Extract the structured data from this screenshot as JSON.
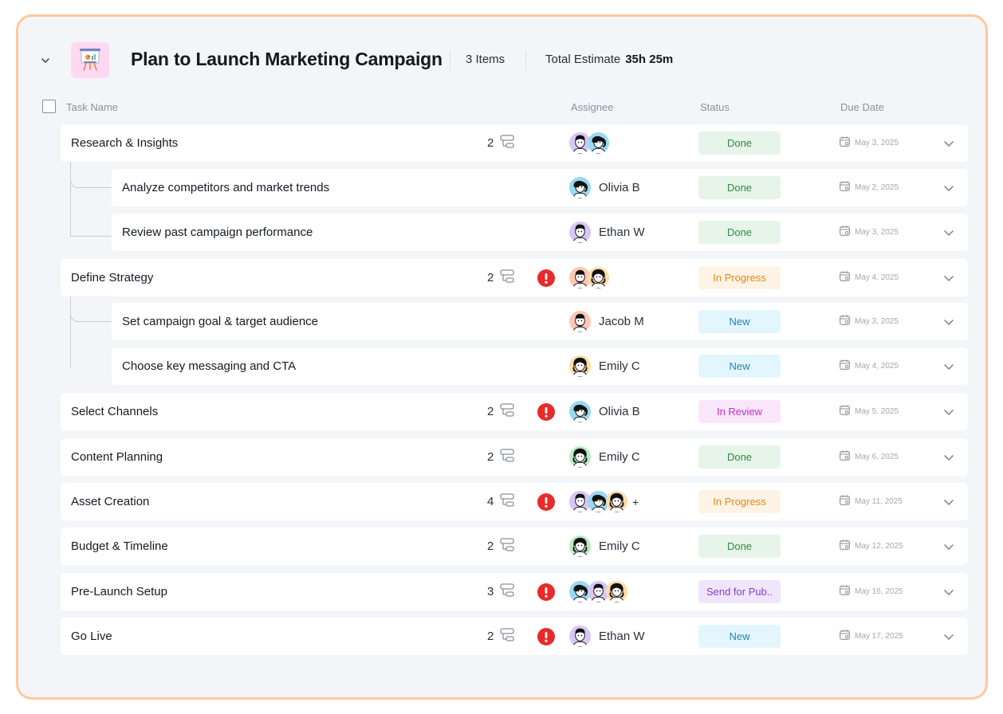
{
  "header": {
    "title": "Plan to Launch Marketing Campaign",
    "items_count": "3 Items",
    "estimate_label": "Total Estimate",
    "estimate_value": "35h 25m"
  },
  "columns": {
    "task_name": "Task Name",
    "assignee": "Assignee",
    "status": "Status",
    "due_date": "Due Date"
  },
  "colors": {
    "panel_border": "#ffc8a0",
    "alert": "#ea2a2a",
    "done": "#2f8c3f",
    "in_progress": "#e38a17",
    "new": "#1d87b0",
    "in_review": "#c32ec3",
    "send_for_publish": "#8e3bd1"
  },
  "tasks": [
    {
      "name": "Research & Insights",
      "level": "parent",
      "subtasks": "2",
      "alert": false,
      "assignees": [
        "ethan",
        "olivia"
      ],
      "assignee_name": "",
      "status": "Done",
      "status_kind": "done",
      "due": "May 3, 2025"
    },
    {
      "name": "Analyze competitors and market trends",
      "level": "child",
      "subtasks": "",
      "alert": false,
      "assignees": [
        "olivia"
      ],
      "assignee_name": "Olivia B",
      "status": "Done",
      "status_kind": "done",
      "due": "May 2, 2025"
    },
    {
      "name": "Review past campaign performance",
      "level": "child",
      "subtasks": "",
      "alert": false,
      "assignees": [
        "ethan"
      ],
      "assignee_name": "Ethan W",
      "status": "Done",
      "status_kind": "done",
      "due": "May 3, 2025"
    },
    {
      "name": "Define Strategy",
      "level": "parent",
      "subtasks": "2",
      "alert": true,
      "assignees": [
        "jacob",
        "emily"
      ],
      "assignee_name": "",
      "status": "In Progress",
      "status_kind": "progress",
      "due": "May 4, 2025"
    },
    {
      "name": "Set campaign goal & target audience",
      "level": "child",
      "subtasks": "",
      "alert": false,
      "assignees": [
        "jacob"
      ],
      "assignee_name": "Jacob M",
      "status": "New",
      "status_kind": "new",
      "due": "May 3, 2025"
    },
    {
      "name": "Choose key messaging and CTA",
      "level": "child",
      "subtasks": "",
      "alert": false,
      "assignees": [
        "emily"
      ],
      "assignee_name": "Emily C",
      "status": "New",
      "status_kind": "new",
      "due": "May 4, 2025"
    },
    {
      "name": "Select Channels",
      "level": "parent",
      "subtasks": "2",
      "alert": true,
      "assignees": [
        "olivia"
      ],
      "assignee_name": "Olivia B",
      "status": "In Review",
      "status_kind": "review",
      "due": "May 5, 2025"
    },
    {
      "name": "Content Planning",
      "level": "parent",
      "subtasks": "2",
      "alert": false,
      "assignees": [
        "emily-green"
      ],
      "assignee_name": "Emily C",
      "status": "Done",
      "status_kind": "done",
      "due": "May 6, 2025"
    },
    {
      "name": "Asset Creation",
      "level": "parent",
      "subtasks": "4",
      "alert": true,
      "assignees": [
        "ethan",
        "olivia",
        "emily"
      ],
      "assignee_name": "",
      "extra": "+",
      "status": "In Progress",
      "status_kind": "progress",
      "due": "May 11, 2025"
    },
    {
      "name": "Budget & Timeline",
      "level": "parent",
      "subtasks": "2",
      "alert": false,
      "assignees": [
        "emily-green"
      ],
      "assignee_name": "Emily C",
      "status": "Done",
      "status_kind": "done",
      "due": "May 12, 2025"
    },
    {
      "name": "Pre-Launch Setup",
      "level": "parent",
      "subtasks": "3",
      "alert": true,
      "assignees": [
        "olivia",
        "ethan",
        "emily"
      ],
      "assignee_name": "",
      "status": "Send for Pub..",
      "status_kind": "pub",
      "due": "May 16, 2025"
    },
    {
      "name": "Go Live",
      "level": "parent",
      "subtasks": "2",
      "alert": true,
      "assignees": [
        "ethan"
      ],
      "assignee_name": "Ethan W",
      "status": "New",
      "status_kind": "new",
      "due": "May 17, 2025"
    }
  ]
}
